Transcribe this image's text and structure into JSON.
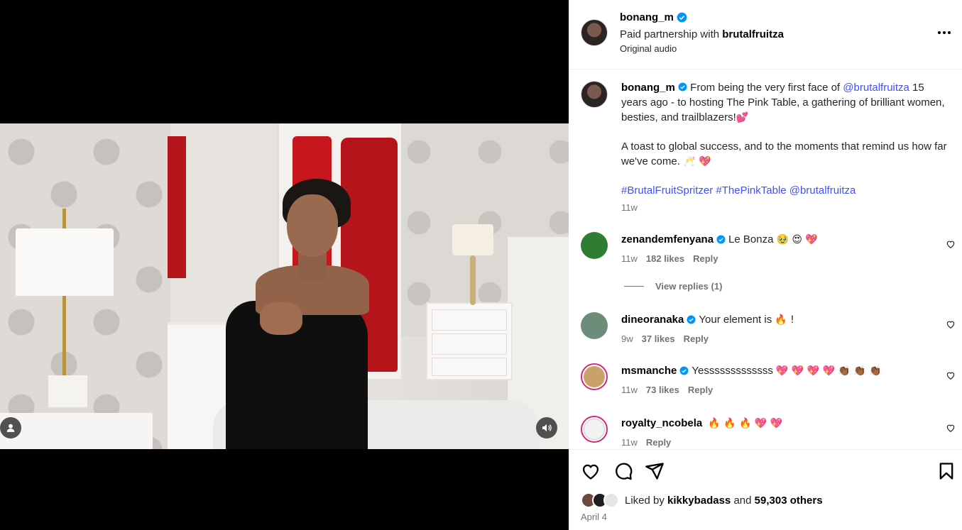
{
  "post": {
    "author": "bonang_m",
    "paid_prefix": "Paid partnership with ",
    "partner": "brutalfruitza",
    "audio": "Original audio"
  },
  "caption": {
    "username": "bonang_m",
    "text_1a": " From being the very first face of ",
    "mention": "@brutalfruitza",
    "text_1b": " 15 years ago - to hosting The Pink Table, a gathering of brilliant women, besties, and trailblazers!",
    "emoji_1": "💕",
    "text_2": "A toast to global success, and to the moments that remind us how far we've come. ",
    "emoji_2": "🥂 💖",
    "hashtag_1": "#BrutalFruitSpritzer",
    "hashtag_2": "#ThePinkTable",
    "hashtag_mention": "@brutalfruitza",
    "time": "11w"
  },
  "comments": [
    {
      "username": "zenandemfenyana",
      "text": "Le Bonza",
      "emoji": "🥹 😍 💖",
      "time": "11w",
      "likes": "182 likes",
      "reply": "Reply",
      "color": "#2e7d32"
    },
    {
      "username": "dineoranaka",
      "text": "Your element is",
      "emoji": "🔥 !",
      "time": "9w",
      "likes": "37 likes",
      "reply": "Reply",
      "color": "#6d8c7a"
    },
    {
      "username": "msmanche",
      "text": "Yesssssssssssss",
      "emoji": "💖 💖 💖 💖 👏🏾 👏🏾 👏🏾",
      "time": "11w",
      "likes": "73 likes",
      "reply": "Reply",
      "color": "#c9a26b"
    },
    {
      "username": "royalty_ncobela",
      "text": "",
      "emoji": "🔥 🔥 🔥 💖 💖",
      "time": "11w",
      "likes": "",
      "reply": "Reply",
      "color": "#555555"
    }
  ],
  "view_replies": "View replies (1)",
  "likes": {
    "prefix": "Liked by ",
    "user": "kikkybadass",
    "middle": " and ",
    "count": "59,303 others"
  },
  "date": "April 4",
  "colors": {
    "link": "#4150f7",
    "verified": "#0095f6",
    "ring": "#d62976"
  },
  "icons": [
    "heart-icon",
    "comment-icon",
    "share-icon",
    "bookmark-icon",
    "more-icon",
    "verified-icon",
    "mute-icon",
    "user-tag-icon"
  ]
}
